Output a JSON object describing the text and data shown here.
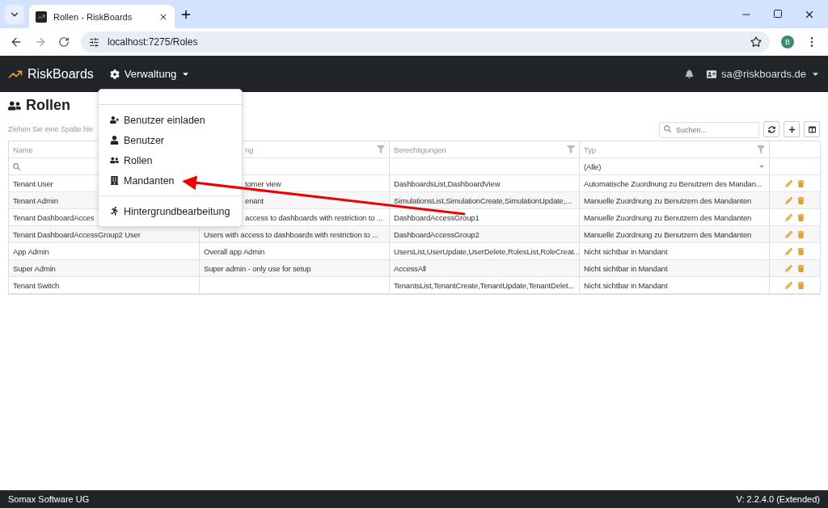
{
  "browser": {
    "tab_title": "Rollen - RiskBoards",
    "url": "localhost:7275/Roles",
    "profile_initial": "B"
  },
  "navbar": {
    "brand": "RiskBoards",
    "menu_label": "Verwaltung",
    "user": "sa@riskboards.de"
  },
  "menu": {
    "groups": [
      [
        "Benutzer einladen",
        "Benutzer",
        "Rollen",
        "Mandanten"
      ],
      [
        "Hintergrundbearbeitung"
      ]
    ]
  },
  "page": {
    "title": "Rollen",
    "group_hint": "Ziehen Sie eine Spalte hie",
    "search_placeholder": "Suchen..."
  },
  "table": {
    "columns": [
      {
        "label": "Name",
        "filter": false
      },
      {
        "label": "ng",
        "filter": true
      },
      {
        "label": "Berechtigungen",
        "filter": true
      },
      {
        "label": "Typ",
        "filter": true
      }
    ],
    "type_filter": "(Alle)",
    "rows": [
      {
        "cells": [
          "Tenant User",
          "tomer view",
          "DashboardsList,DashboardView",
          "Automatische Zuordnung zu Benutzern des Mandan..."
        ]
      },
      {
        "cells": [
          "Tenant Admin",
          "enant",
          "SimulationsList,SimulationCreate,SimulationUpdate,...",
          "Manuelle Zuordnung zu Benutzern des Mandanten"
        ]
      },
      {
        "cells": [
          "Tenant DashboardAcces",
          "access to dashboards with restriction to ...",
          "DashboardAccessGroup1",
          "Manuelle Zuordnung zu Benutzern des Mandanten"
        ]
      },
      {
        "cells": [
          "Tenant DashboardAccessGroup2 User",
          "Users with access to dashboards with restriction to ...",
          "DashboardAccessGroup2",
          "Manuelle Zuordnung zu Benutzern des Mandanten"
        ]
      },
      {
        "cells": [
          "App Admin",
          "Overall app Admin",
          "UsersList,UserUpdate,UserDelete,RolesList,RoleCreat...",
          "Nicht sichtbar in Mandant"
        ]
      },
      {
        "cells": [
          "Super Admin",
          "Super admin - only use for setup",
          "AccessAll",
          "Nicht sichtbar in Mandant"
        ]
      },
      {
        "cells": [
          "Tenant Switch",
          "",
          "TenantsList,TenantCreate,TenantUpdate,TenantDelet...",
          "Nicht sichtbar in Mandant"
        ]
      }
    ]
  },
  "footer": {
    "company": "Somax Software UG",
    "version": "V: 2.2.4.0 (Extended)"
  }
}
